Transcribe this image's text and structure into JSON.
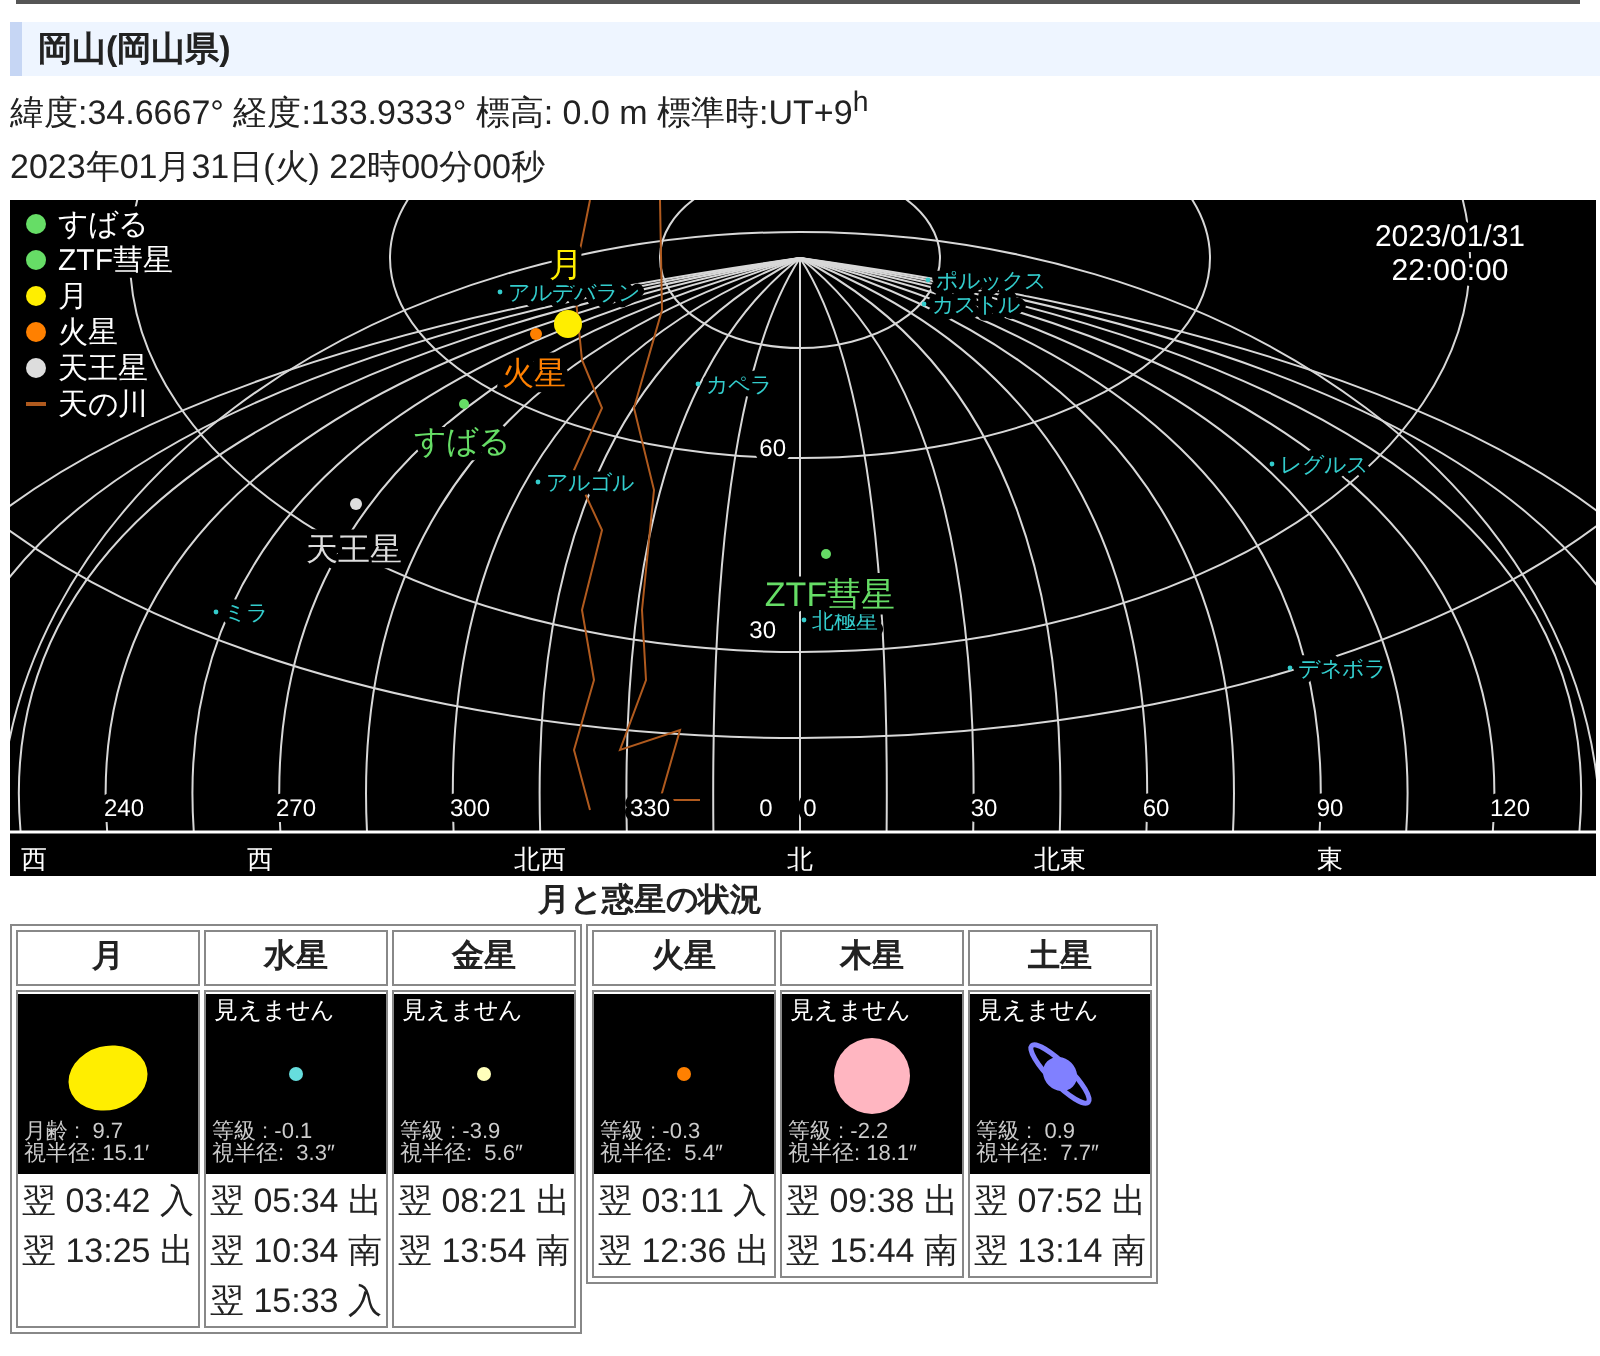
{
  "location": {
    "title": "岡山(岡山県)",
    "coords": "緯度:34.6667° 経度:133.9333° 標高: 0.0 m 標準時:UT+9$^{h}$",
    "datetime": "2023年01月31日(火) 22時00分00秒"
  },
  "sky_chart": {
    "date": "2023/01/31",
    "time": "22:00:00",
    "legend": [
      {
        "label": "すばる",
        "kind": "dot",
        "color": "#66dd66"
      },
      {
        "label": "ZTF彗星",
        "kind": "dot",
        "color": "#66dd66"
      },
      {
        "label": "月",
        "kind": "dot",
        "color": "#ffee00"
      },
      {
        "label": "火星",
        "kind": "dot",
        "color": "#ff8000"
      },
      {
        "label": "天王星",
        "kind": "dot",
        "color": "#dddddd"
      },
      {
        "label": "天の川",
        "kind": "line",
        "color": "#b05a1e"
      }
    ],
    "bodies": [
      {
        "label": "月",
        "kind": "moon",
        "color": "#ffee00"
      },
      {
        "label": "火星",
        "kind": "planet",
        "color": "#ff8000"
      },
      {
        "label": "すばる",
        "kind": "cluster",
        "color": "#66dd66"
      },
      {
        "label": "天王星",
        "kind": "planet",
        "color": "#dddddd"
      },
      {
        "label": "ZTF彗星",
        "kind": "comet",
        "color": "#66dd66"
      }
    ],
    "stars": [
      "アルデバラン",
      "カペラ",
      "アルゴル",
      "ミラ",
      "カストル",
      "ポルックス",
      "レグルス",
      "北極星",
      "デネボラ"
    ],
    "altitude_labels": [
      "60",
      "30"
    ],
    "azimuth_labels": [
      "240",
      "270",
      "300",
      "330",
      "0",
      "0",
      "30",
      "60",
      "90",
      "120"
    ],
    "directions": [
      "西",
      "西",
      "北西",
      "北",
      "北東",
      "東"
    ]
  },
  "planets": {
    "title": "月と惑星の状況",
    "groups": [
      [
        {
          "name": "月",
          "kind": "moon",
          "color": "#ffee00",
          "stat_1": "月齢 :  9.7",
          "stat_2": "視半径: 15.1′",
          "events": [
            "翌 03:42 入",
            "翌 13:25 出"
          ]
        },
        {
          "name": "水星",
          "kind": "dot",
          "color": "#66dddd",
          "note": "見えません",
          "stat_1": "等級 : -0.1",
          "stat_2": "視半径:  3.3″",
          "events": [
            "翌 05:34 出",
            "翌 10:34 南",
            "翌 15:33 入"
          ]
        },
        {
          "name": "金星",
          "kind": "dot",
          "color": "#ffffbb",
          "note": "見えません",
          "stat_1": "等級 : -3.9",
          "stat_2": "視半径:  5.6″",
          "events": [
            "翌 08:21 出",
            "翌 13:54 南"
          ]
        }
      ],
      [
        {
          "name": "火星",
          "kind": "dot",
          "color": "#ff8000",
          "stat_1": "等級 : -0.3",
          "stat_2": "視半径:  5.4″",
          "events": [
            "翌 03:11 入",
            "翌 12:36 出"
          ]
        },
        {
          "name": "木星",
          "kind": "disk",
          "color": "#ffb6c1",
          "note": "見えません",
          "stat_1": "等級 : -2.2",
          "stat_2": "視半径: 18.1″",
          "events": [
            "翌 09:38 出",
            "翌 15:44 南"
          ]
        },
        {
          "name": "土星",
          "kind": "ringed",
          "color": "#8080ff",
          "note": "見えません",
          "stat_1": "等級 :  0.9",
          "stat_2": "視半径:  7.7″",
          "events": [
            "翌 07:52 出",
            "翌 13:14 南"
          ]
        }
      ]
    ]
  }
}
